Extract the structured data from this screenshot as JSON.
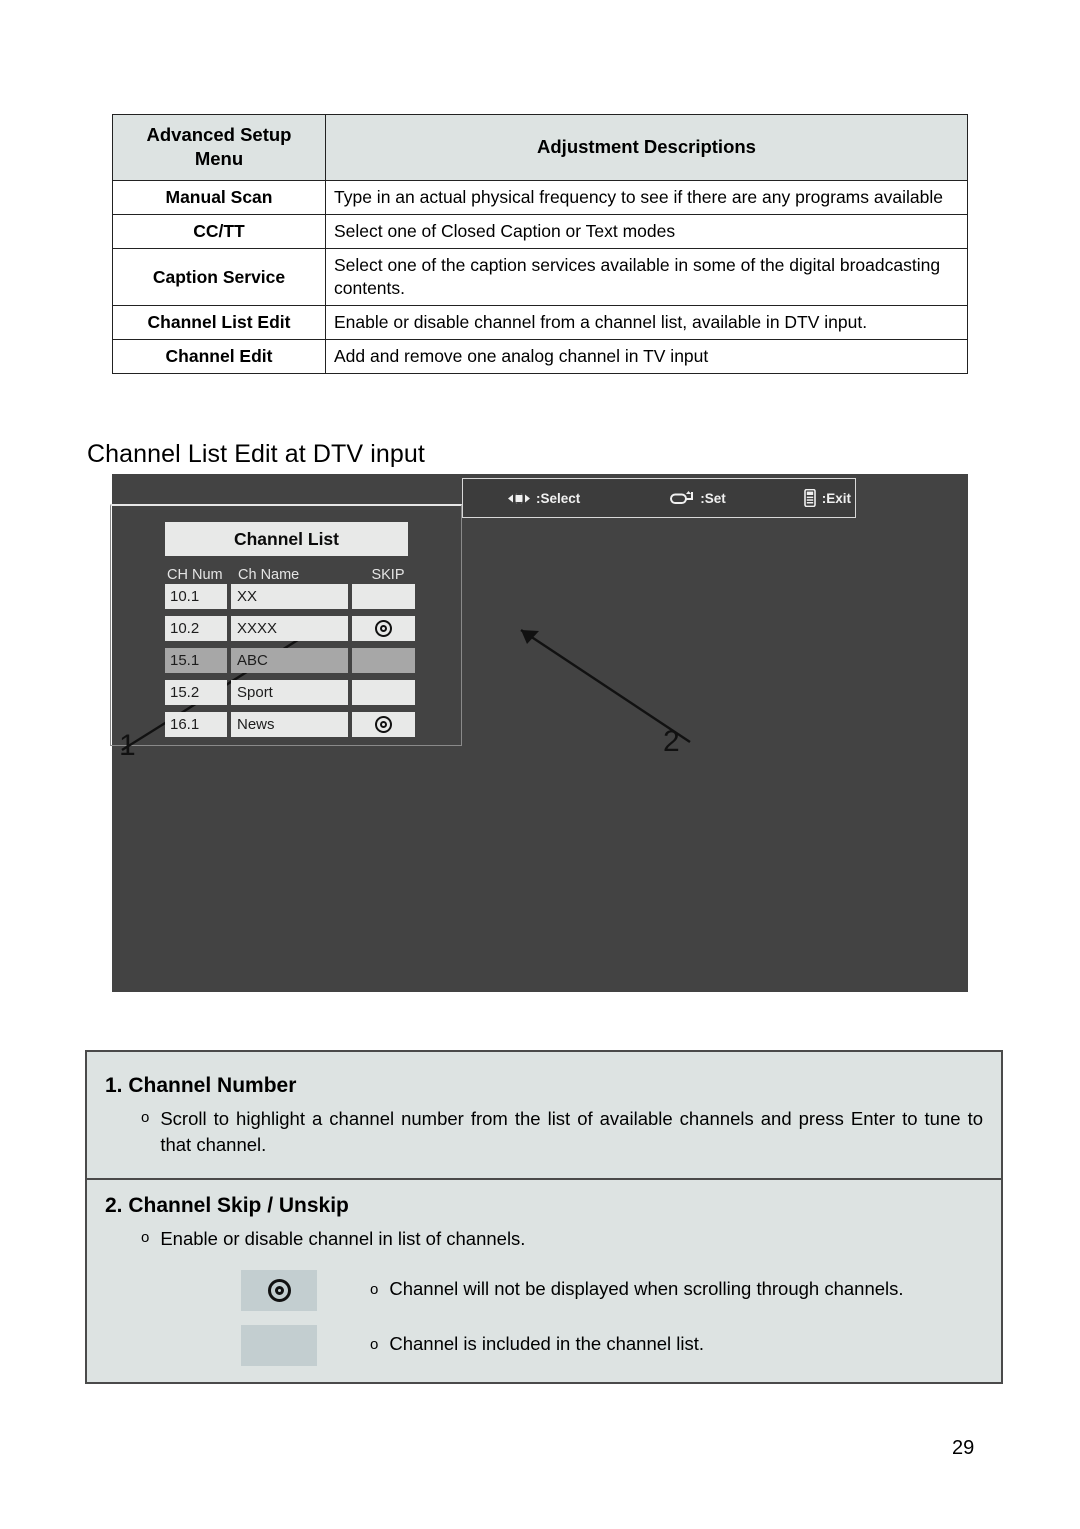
{
  "setup_table": {
    "headers": [
      "Advanced Setup Menu",
      "Adjustment Descriptions"
    ],
    "rows": [
      {
        "menu": "Manual Scan",
        "description": "Type in an actual physical frequency to see if there are any programs available"
      },
      {
        "menu": "CC/TT",
        "description": "Select one of Closed Caption or Text modes"
      },
      {
        "menu": "Caption Service",
        "description": "Select one of the caption services available in some of the digital broadcasting contents."
      },
      {
        "menu": "Channel List Edit",
        "description": "Enable or disable channel from a channel list,  available in DTV input."
      },
      {
        "menu": "Channel Edit",
        "description": "Add and remove one analog channel in TV input"
      }
    ]
  },
  "section": {
    "heading": "Channel List Edit at DTV input"
  },
  "tv_screen": {
    "osd": {
      "title": "Channel List",
      "columns": [
        "CH Num",
        "Ch  Name",
        "SKIP"
      ],
      "rows": [
        {
          "num": "10.1",
          "name": "XX",
          "skip": false,
          "selected": false
        },
        {
          "num": "10.2",
          "name": "XXXX",
          "skip": true,
          "selected": false
        },
        {
          "num": "15.1",
          "name": "ABC",
          "skip": false,
          "selected": true
        },
        {
          "num": "15.2",
          "name": "Sport",
          "skip": false,
          "selected": false
        },
        {
          "num": "16.1",
          "name": "News",
          "skip": true,
          "selected": false
        }
      ]
    },
    "hint_bar": [
      {
        "icon": "dpad-icon",
        "label": ":Select"
      },
      {
        "icon": "enter-icon",
        "label": ":Set"
      },
      {
        "icon": "remote-icon",
        "label": ":Exit"
      }
    ],
    "callouts": [
      {
        "number": "1",
        "target": "channel-number-column"
      },
      {
        "number": "2",
        "target": "skip-column"
      }
    ],
    "background_color": "#434343"
  },
  "notes": {
    "block1": {
      "title": "1. Channel Number",
      "bullet_mark": "o",
      "text": "Scroll to highlight a channel number from the list of available channels and press Enter to tune to that channel."
    },
    "block2": {
      "title": "2. Channel Skip / Unskip",
      "bullet_mark": "o",
      "text": "Enable or disable channel in list of channels.",
      "legend": [
        {
          "swatch": "skip-on",
          "bullet_mark": "o",
          "text": "Channel will not be displayed when scrolling through channels."
        },
        {
          "swatch": "skip-off",
          "bullet_mark": "o",
          "text": "Channel is included in the channel list."
        }
      ]
    }
  },
  "page_number": "29",
  "colors": {
    "table_header_bg": "#dde3e2",
    "panel_bg": "#dde3e2",
    "tv_bg": "#434343",
    "osd_cell_bg": "#e8e9e8",
    "osd_selected_bg": "#a7a7a7",
    "swatch_bg": "#c3ced0"
  }
}
